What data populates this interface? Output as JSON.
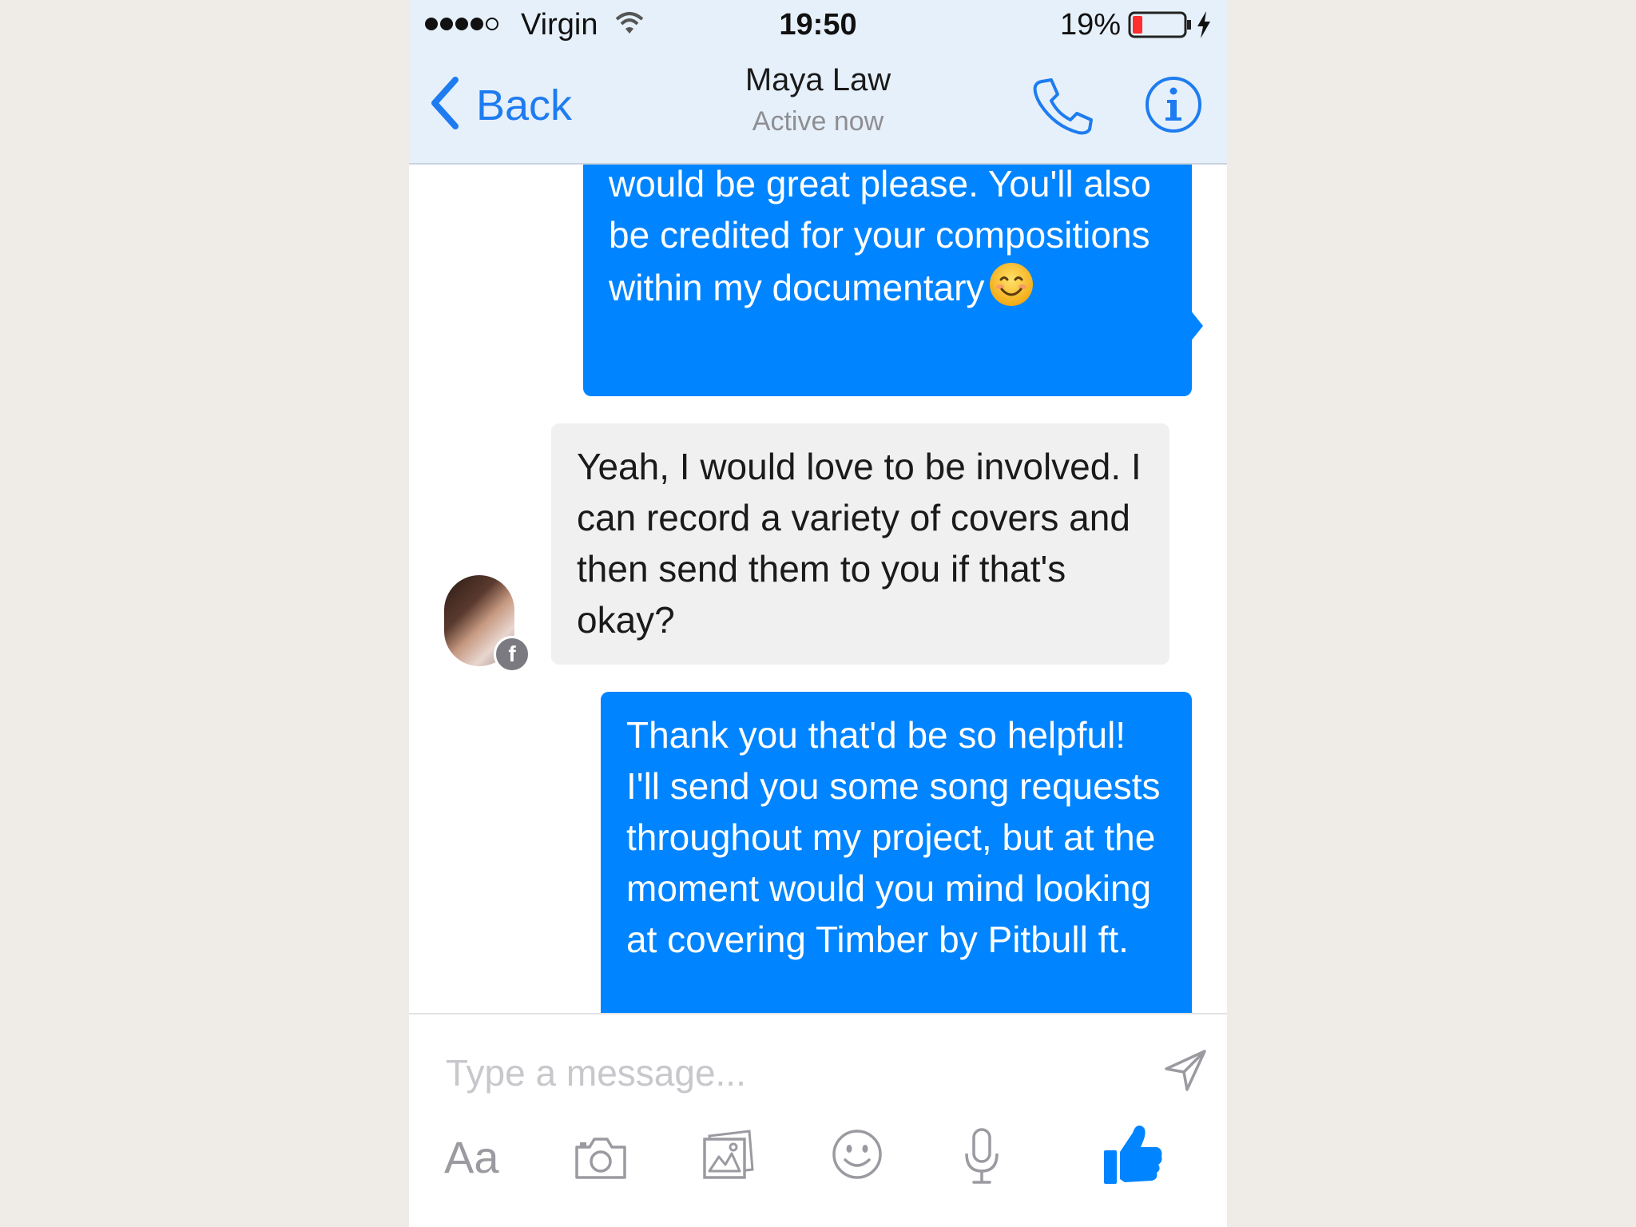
{
  "status_bar": {
    "carrier": "Virgin",
    "time": "19:50",
    "battery": "19%",
    "battery_level": 0.19
  },
  "header": {
    "back_label": "Back",
    "contact_name": "Maya Law",
    "contact_status": "Active now",
    "icons": [
      "chevron-left-icon",
      "phone-icon",
      "info-icon"
    ]
  },
  "messages": [
    {
      "direction": "outgoing",
      "text": "would be great please. You'll also be credited for your compositions within my documentary",
      "emoji": "smiling-face-emoji"
    },
    {
      "direction": "incoming",
      "text": "Yeah, I would love to be involved. I can record a variety of covers and then send them to you if that's okay?"
    },
    {
      "direction": "outgoing",
      "text": "Thank you that'd be so helpful! I'll send you some song requests throughout my project, but at the moment would you mind looking at covering Timber by Pitbull ft."
    }
  ],
  "composer": {
    "placeholder": "Type a message...",
    "text_tool_label": "Aa",
    "tools": [
      "text-format",
      "camera-icon",
      "gallery-icon",
      "emoji-icon",
      "microphone-icon",
      "like-icon"
    ]
  },
  "colors": {
    "accent": "#0084ff",
    "link": "#1e7cf0",
    "incoming_bubble": "#f1f0f0"
  }
}
